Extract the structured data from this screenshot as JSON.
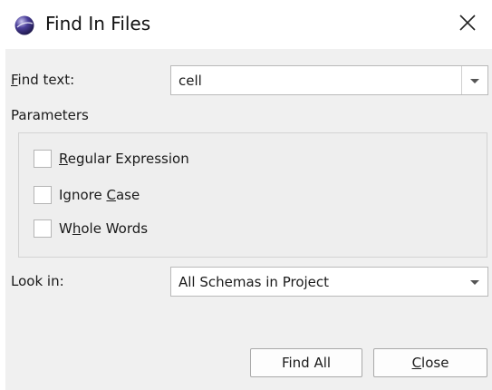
{
  "window": {
    "title": "Find In Files",
    "icon": "app-sphere-icon",
    "close_icon": "close-icon"
  },
  "find_text": {
    "label_mnemonic": "F",
    "label_rest": "ind text:",
    "value": "cell",
    "dropdown_icon": "chevron-down-icon"
  },
  "parameters": {
    "title": "Parameters",
    "options": [
      {
        "prefix": "",
        "mnemonic": "R",
        "suffix": "egular Expression",
        "checked": false
      },
      {
        "prefix": "Ignore ",
        "mnemonic": "C",
        "suffix": "ase",
        "checked": false
      },
      {
        "prefix": "W",
        "mnemonic": "h",
        "suffix": "ole Words",
        "checked": false
      }
    ]
  },
  "look_in": {
    "label": "Look in:",
    "value": "All Schemas in Project",
    "dropdown_icon": "chevron-down-icon"
  },
  "buttons": {
    "find_all": "Find All",
    "close_mnemonic": "C",
    "close_rest": "lose"
  },
  "colors": {
    "dialog_bg": "#f0f0f0",
    "title_bg": "#ffffff",
    "border": "#b9b9b9"
  }
}
